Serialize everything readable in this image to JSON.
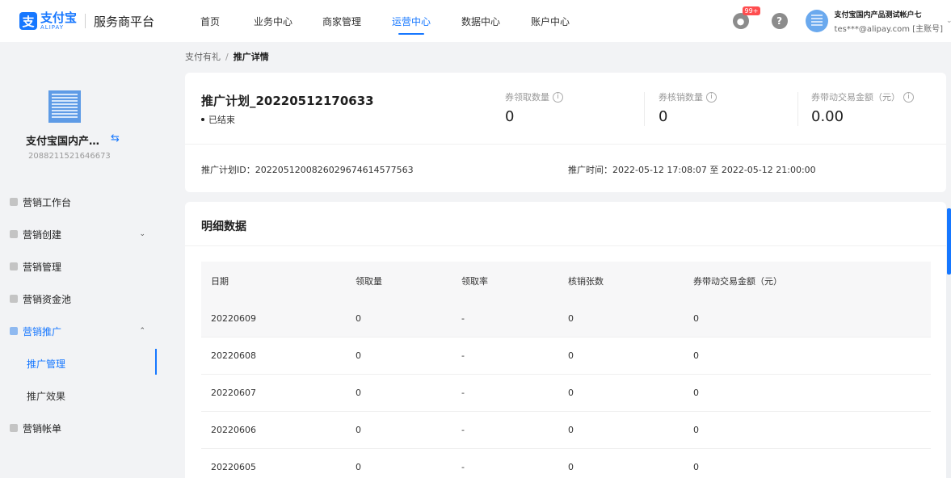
{
  "brand": {
    "name_cn": "支付宝",
    "name_en": "ALIPAY",
    "platform": "服务商平台",
    "logo_glyph": "支"
  },
  "nav": {
    "items": [
      {
        "label": "首页",
        "active": false
      },
      {
        "label": "业务中心",
        "active": false
      },
      {
        "label": "商家管理",
        "active": false
      },
      {
        "label": "运营中心",
        "active": true
      },
      {
        "label": "数据中心",
        "active": false
      },
      {
        "label": "账户中心",
        "active": false
      }
    ]
  },
  "header_right": {
    "notification_badge": "99+",
    "help_glyph": "?",
    "account_name": "支付宝国内产品测试帐户七",
    "account_email": "tes***@alipay.com [主账号]"
  },
  "sidebar": {
    "merchant_name": "支付宝国内产…",
    "merchant_id": "2088211521646673",
    "menu": [
      {
        "label": "营销工作台"
      },
      {
        "label": "营销创建",
        "caret": "⌄"
      },
      {
        "label": "营销管理"
      },
      {
        "label": "营销资金池"
      },
      {
        "label": "营销推广",
        "caret": "⌃",
        "open": true
      }
    ],
    "submenu": [
      {
        "label": "推广管理",
        "active": true
      },
      {
        "label": "推广效果",
        "active": false
      }
    ],
    "menu_after": [
      {
        "label": "营销帐单"
      }
    ]
  },
  "breadcrumb": {
    "parent": "支付有礼",
    "separator": "/",
    "current": "推广详情"
  },
  "summary": {
    "title": "推广计划_20220512170633",
    "status": "已结束",
    "metrics": [
      {
        "label": "券领取数量",
        "value": "0"
      },
      {
        "label": "券核销数量",
        "value": "0"
      },
      {
        "label": "券带动交易金额（元）",
        "value": "0.00"
      }
    ],
    "plan_id": "推广计划ID：2022051200826029674614577563",
    "plan_time": "推广时间：2022-05-12 17:08:07 至 2022-05-12 21:00:00"
  },
  "detail": {
    "title": "明细数据",
    "columns": [
      "日期",
      "领取量",
      "领取率",
      "核销张数",
      "券带动交易金额（元）"
    ],
    "rows": [
      [
        "20220609",
        "0",
        "-",
        "0",
        "0"
      ],
      [
        "20220608",
        "0",
        "-",
        "0",
        "0"
      ],
      [
        "20220607",
        "0",
        "-",
        "0",
        "0"
      ],
      [
        "20220606",
        "0",
        "-",
        "0",
        "0"
      ],
      [
        "20220605",
        "0",
        "-",
        "0",
        "0"
      ]
    ]
  },
  "colors": {
    "accent": "#1677ff",
    "badge": "#ff4d4f",
    "page_bg": "#f2f3f5"
  }
}
